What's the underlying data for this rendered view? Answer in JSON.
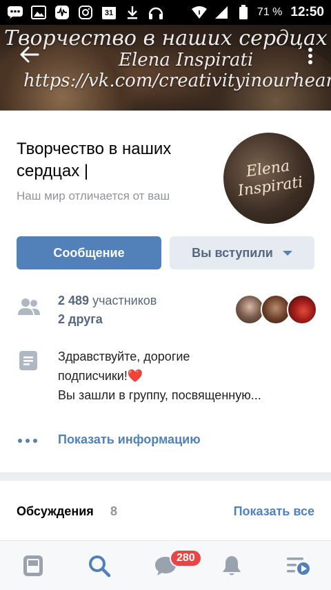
{
  "status_bar": {
    "battery": "71 %",
    "time": "12:50",
    "calendar_day": "31"
  },
  "cover": {
    "line1": "Творчество в наших сердцах",
    "line2": "Elena Inspirati",
    "line3": "https://vk.com/creativityinourheart"
  },
  "avatar": {
    "text_line1": "Elena",
    "text_line2": "Inspirati"
  },
  "header": {
    "title": "Творчество в наших сердцах |",
    "status": "Наш мир отличается от ваш"
  },
  "actions": {
    "message_label": "Сообщение",
    "joined_label": "Вы вступили"
  },
  "members": {
    "count": "2 489",
    "count_label": "участников",
    "friends": "2 друга"
  },
  "description": {
    "line1": "Здравствуйте, дорогие",
    "line2": "подписчики!",
    "line2_emoji": "❤️",
    "line3": "Вы зашли в группу, посвященную..."
  },
  "info_link": "Показать информацию",
  "discussions": {
    "title": "Обсуждения",
    "count": "8",
    "show_all": "Показать все"
  },
  "nav": {
    "messages_badge": "280"
  },
  "colors": {
    "accent": "#5181b8",
    "secondary_button": "#e5ebf1",
    "muted_text": "#8e949b",
    "badge": "#e64646"
  }
}
